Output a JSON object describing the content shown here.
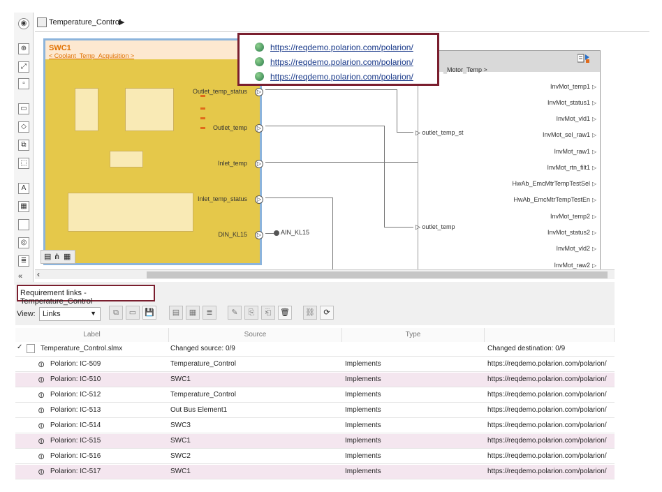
{
  "breadcrumb": {
    "model": "Temperature_Control"
  },
  "swc1": {
    "title": "SWC1",
    "subtitle": "< Coolant_Temp_Acquisition >",
    "ports": [
      "Outlet_temp_status",
      "Outlet_temp",
      "Inlet_temp",
      "Inlet_temp_status",
      "DIN_KL15"
    ],
    "ain": "AIN_KL15"
  },
  "motor_block": {
    "title": "_Motor_Temp >",
    "outlets": [
      "outlet_temp_st",
      "outlet_temp"
    ],
    "ports": [
      "InvMot_temp1",
      "InvMot_status1",
      "InvMot_vld1",
      "InvMot_sel_raw1",
      "InvMot_raw1",
      "InvMot_rtn_filt1",
      "HwAb_EmcMtrTempTestSel",
      "HwAb_EmcMtrTempTestEn",
      "InvMot_temp2",
      "InvMot_status2",
      "InvMot_vld2",
      "InvMot_raw2"
    ]
  },
  "popup": {
    "links": [
      "https://reqdemo.polarion.com/polarion/",
      "https://reqdemo.polarion.com/polarion/",
      "https://reqdemo.polarion.com/polarion/"
    ]
  },
  "panel": {
    "title": "Requirement links - Temperature_Control",
    "view_label": "View:",
    "view_value": "Links"
  },
  "table": {
    "headers": [
      "Label",
      "Source",
      "Type",
      ""
    ],
    "root": {
      "label": "Temperature_Control.slmx",
      "source": "Changed source: 0/9",
      "type": "",
      "dest": "Changed destination: 0/9"
    },
    "rows": [
      {
        "label": "Polarion: IC-509",
        "source": "Temperature_Control",
        "type": "Implements",
        "dest": "https://reqdemo.polarion.com/polarion/"
      },
      {
        "label": "Polarion: IC-510",
        "source": "SWC1",
        "type": "Implements",
        "dest": "https://reqdemo.polarion.com/polarion/"
      },
      {
        "label": "Polarion: IC-512",
        "source": "Temperature_Control",
        "type": "Implements",
        "dest": "https://reqdemo.polarion.com/polarion/"
      },
      {
        "label": "Polarion: IC-513",
        "source": "Out Bus Element1",
        "type": "Implements",
        "dest": "https://reqdemo.polarion.com/polarion/"
      },
      {
        "label": "Polarion: IC-514",
        "source": "SWC3",
        "type": "Implements",
        "dest": "https://reqdemo.polarion.com/polarion/"
      },
      {
        "label": "Polarion: IC-515",
        "source": "SWC1",
        "type": "Implements",
        "dest": "https://reqdemo.polarion.com/polarion/"
      },
      {
        "label": "Polarion: IC-516",
        "source": "SWC2",
        "type": "Implements",
        "dest": "https://reqdemo.polarion.com/polarion/"
      },
      {
        "label": "Polarion: IC-517",
        "source": "SWC1",
        "type": "Implements",
        "dest": "https://reqdemo.polarion.com/polarion/"
      }
    ]
  },
  "colors": {
    "highlight_border": "#7a1e2e",
    "block_fill": "#e5c84a",
    "row_alt": "#f4e6ef"
  }
}
